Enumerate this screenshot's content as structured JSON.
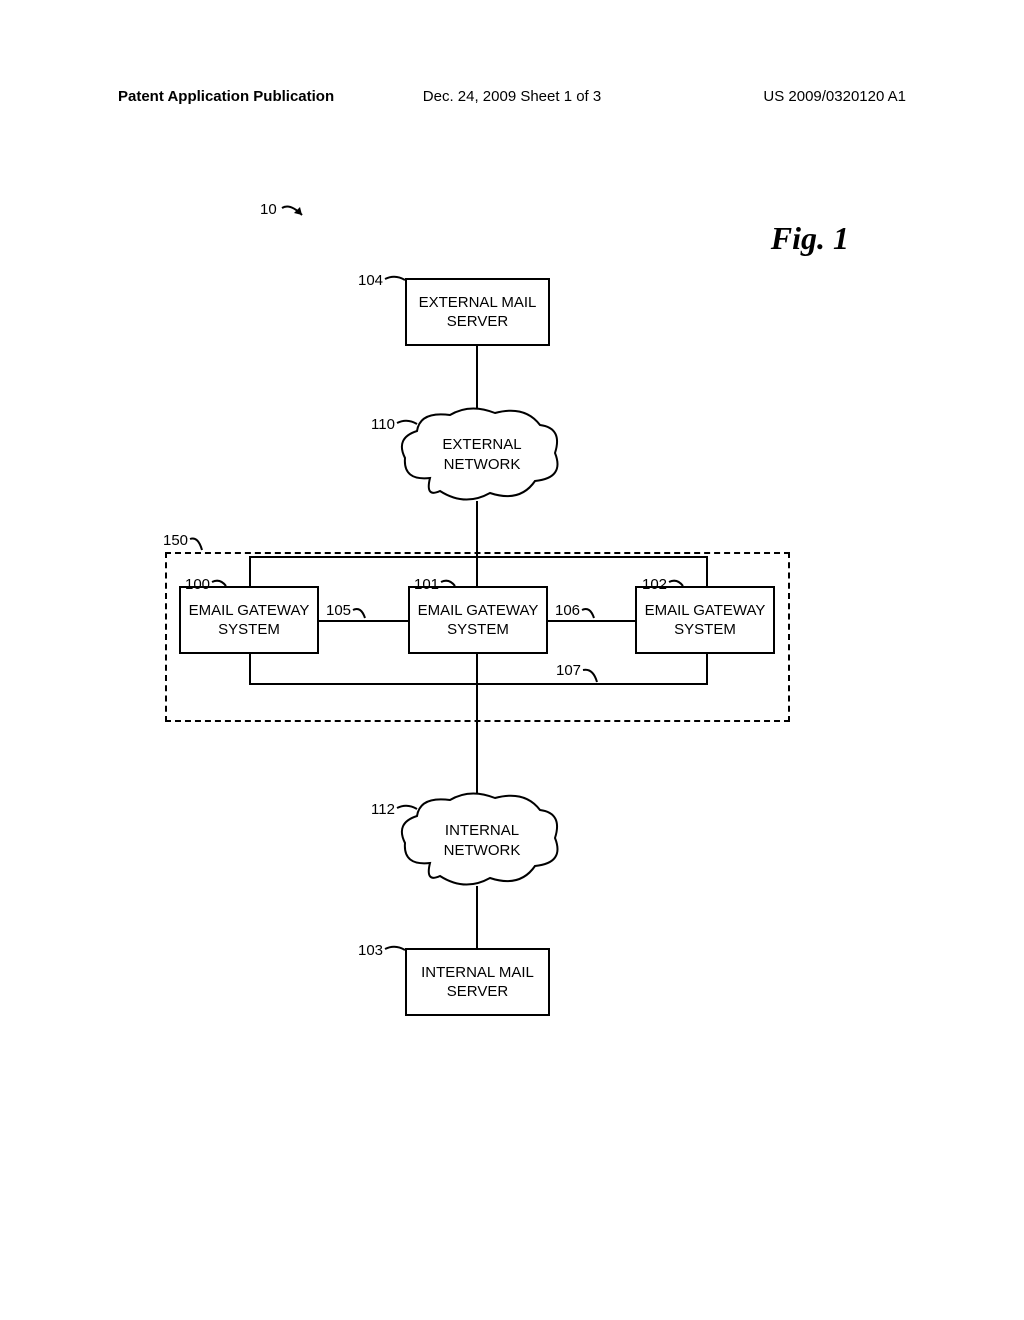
{
  "header": {
    "left": "Patent Application Publication",
    "center": "Dec. 24, 2009  Sheet 1 of 3",
    "right": "US 2009/0320120 A1"
  },
  "figure_title": "Fig. 1",
  "labels": {
    "ref_10": "10",
    "ref_104": "104",
    "ref_110": "110",
    "ref_150": "150",
    "ref_100": "100",
    "ref_101": "101",
    "ref_102": "102",
    "ref_105": "105",
    "ref_106": "106",
    "ref_107": "107",
    "ref_112": "112",
    "ref_103": "103"
  },
  "boxes": {
    "external_mail": "EXTERNAL MAIL\nSERVER",
    "external_network": "EXTERNAL\nNETWORK",
    "gateway_1": "EMAIL GATEWAY\nSYSTEM",
    "gateway_2": "EMAIL GATEWAY\nSYSTEM",
    "gateway_3": "EMAIL GATEWAY\nSYSTEM",
    "internal_network": "INTERNAL\nNETWORK",
    "internal_mail": "INTERNAL MAIL\nSERVER"
  }
}
